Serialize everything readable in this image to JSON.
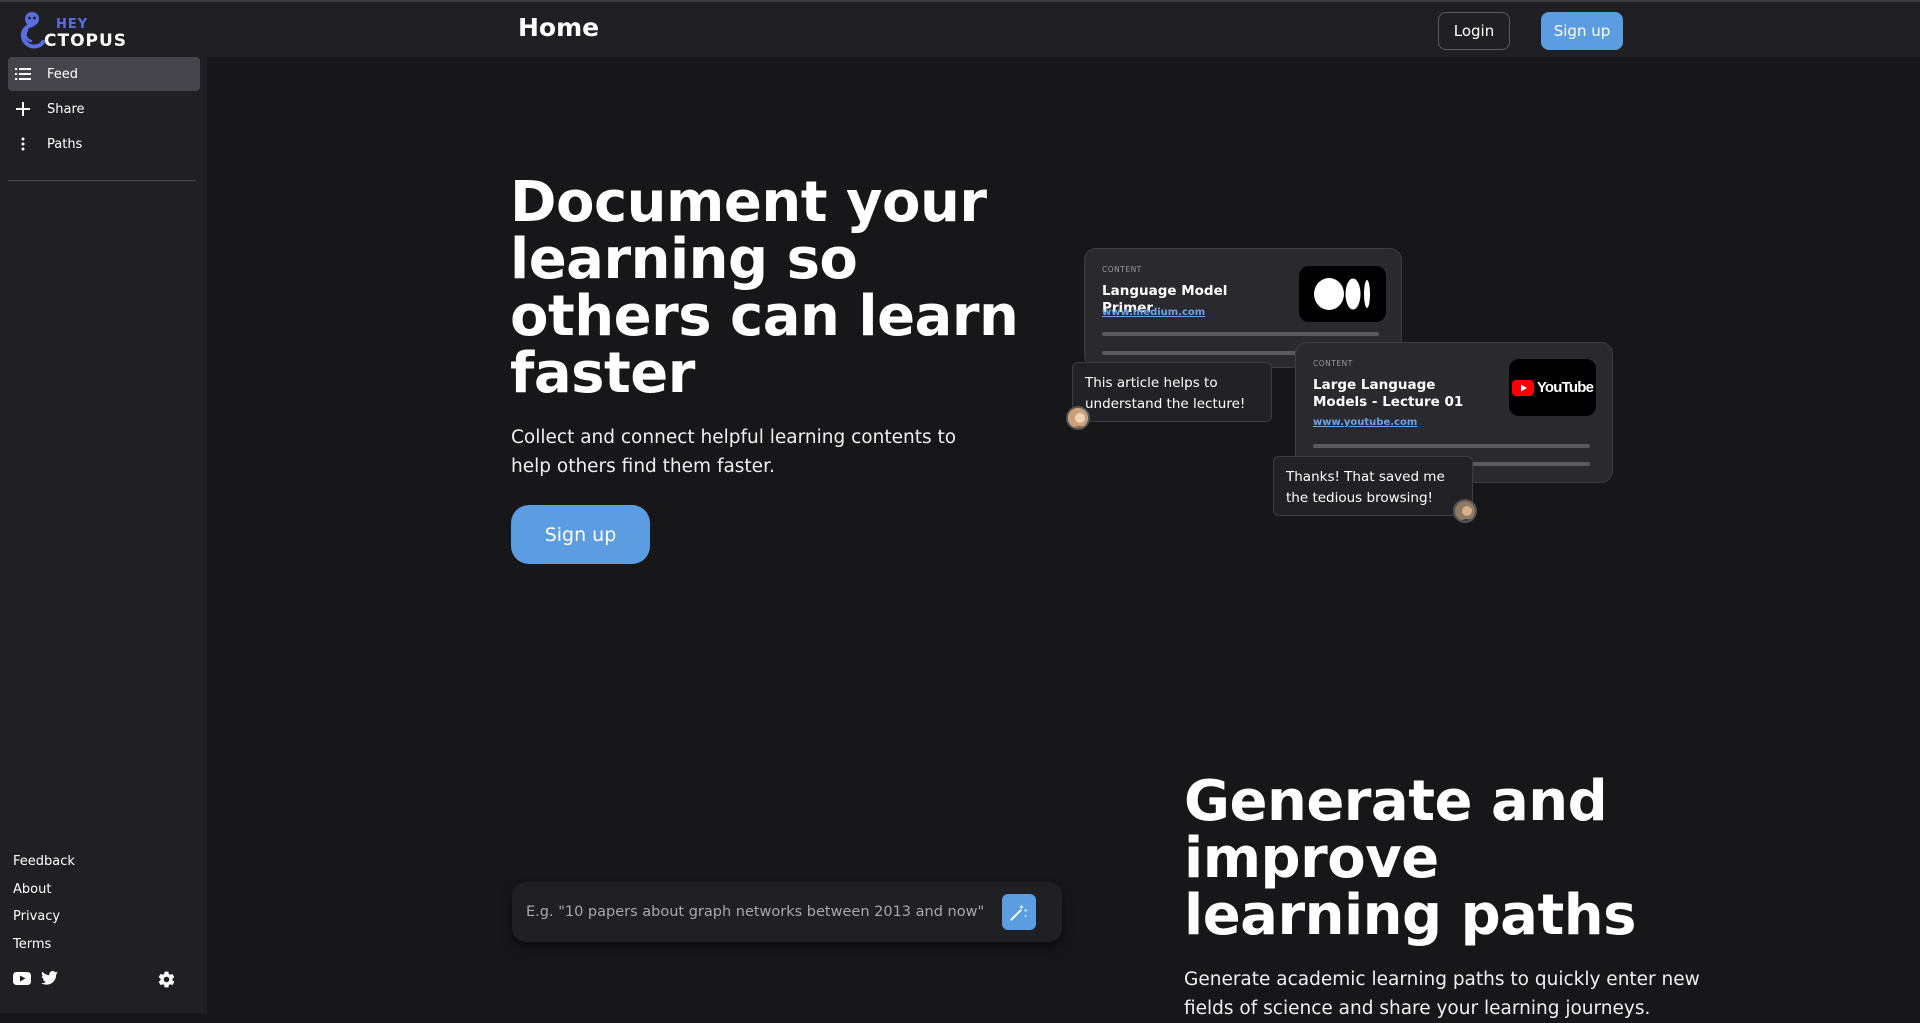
{
  "app": {
    "logo_top": "HEY",
    "logo_bottom": "CTOPUS"
  },
  "sidebar": {
    "items": [
      {
        "label": "Feed",
        "icon": "list-icon",
        "active": true
      },
      {
        "label": "Share",
        "icon": "plus-icon",
        "active": false
      },
      {
        "label": "Paths",
        "icon": "dots-vertical-icon",
        "active": false
      }
    ],
    "footer_links": [
      "Feedback",
      "About",
      "Privacy",
      "Terms"
    ],
    "social": [
      "youtube-icon",
      "twitter-icon"
    ],
    "settings_icon": "gear-icon"
  },
  "header": {
    "title": "Home",
    "login_label": "Login",
    "signup_label": "Sign up"
  },
  "hero": {
    "title": "Document your learning so others can learn faster",
    "subtitle": "Collect and connect helpful learning contents to help others find them faster.",
    "cta_label": "Sign up"
  },
  "illustration": {
    "card1": {
      "label": "CONTENT",
      "title": "Language Model Primer",
      "url": "www.medium.com",
      "thumb": "medium-logo-icon"
    },
    "comment1": "This article helps to understand the lecture!",
    "card2": {
      "label": "CONTENT",
      "title": "Large Language Models - Lecture 01",
      "url": "www.youtube.com",
      "thumb": "youtube-logo-icon",
      "thumb_text": "YouTube"
    },
    "comment2": "Thanks! That saved me the tedious browsing!"
  },
  "section2": {
    "title": "Generate and improve learning paths",
    "subtitle": "Generate academic learning paths to quickly enter new fields of science and share your learning journeys.",
    "search_placeholder": "E.g. \"10 papers about graph networks between 2013 and now\"",
    "magic_icon": "magic-wand-icon"
  },
  "colors": {
    "background": "#17171a",
    "sidebar": "#202024",
    "accent": "#5b9de0",
    "link": "#6aa3e8",
    "logo_accent": "#5a6ee0"
  }
}
